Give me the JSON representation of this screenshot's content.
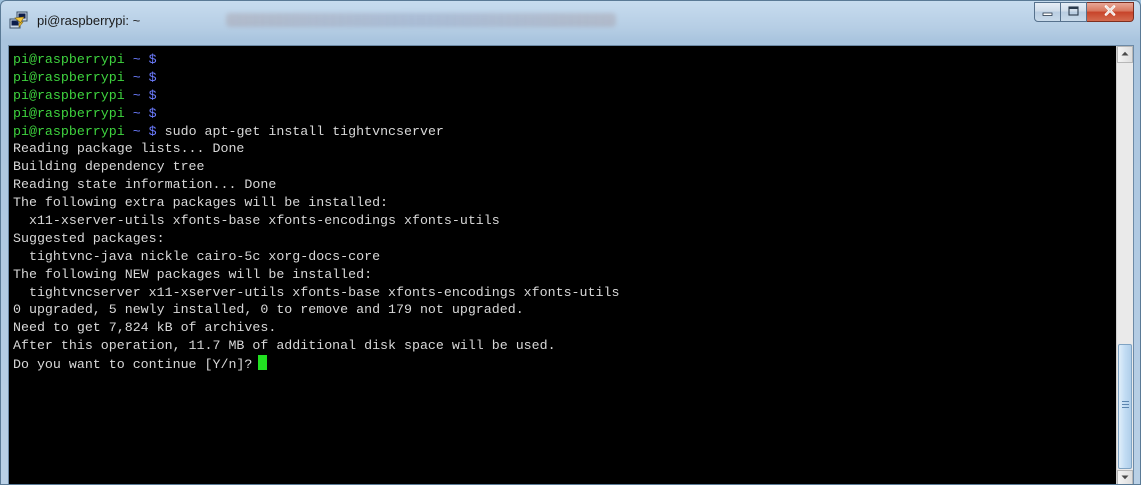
{
  "window": {
    "title": "pi@raspberrypi: ~",
    "icons": {
      "app": "putty-icon",
      "minimize": "minimize-icon",
      "maximize": "maximize-icon",
      "close": "close-icon"
    },
    "colors": {
      "close_button": "#c7432a",
      "titlebar": "#b5cde4"
    }
  },
  "terminal": {
    "prompt_user": "pi@raspberrypi",
    "prompt_symbol": "~ $",
    "prompt_lines": [
      {
        "command": ""
      },
      {
        "command": ""
      },
      {
        "command": ""
      },
      {
        "command": ""
      },
      {
        "command": " sudo apt-get install tightvncserver"
      }
    ],
    "output_lines": [
      "Reading package lists... Done",
      "Building dependency tree",
      "Reading state information... Done",
      "The following extra packages will be installed:",
      "  x11-xserver-utils xfonts-base xfonts-encodings xfonts-utils",
      "Suggested packages:",
      "  tightvnc-java nickle cairo-5c xorg-docs-core",
      "The following NEW packages will be installed:",
      "  tightvncserver x11-xserver-utils xfonts-base xfonts-encodings xfonts-utils",
      "0 upgraded, 5 newly installed, 0 to remove and 179 not upgraded.",
      "Need to get 7,824 kB of archives.",
      "After this operation, 11.7 MB of additional disk space will be used."
    ],
    "final_prompt": "Do you want to continue [Y/n]?",
    "colors": {
      "background": "#000000",
      "text": "#d8d8d8",
      "prompt_user": "#3ed33e",
      "prompt_symbol": "#6c7cff",
      "cursor": "#21e021"
    }
  },
  "scrollbar": {
    "position_fraction": 0.97
  }
}
